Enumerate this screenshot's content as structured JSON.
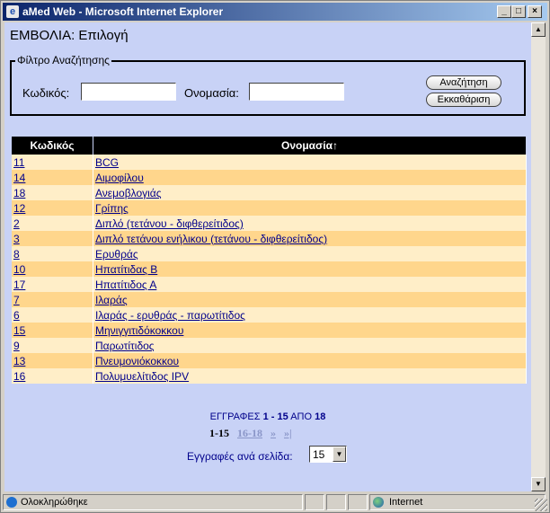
{
  "window": {
    "title": "aMed Web - Microsoft Internet Explorer",
    "minimize": "_",
    "maximize": "□",
    "close": "×"
  },
  "page": {
    "title": "ΕΜΒΟΛΙΑ: Επιλογή"
  },
  "filter": {
    "legend": "Φίλτρο Αναζήτησης",
    "code_label": "Κωδικός:",
    "code_value": "",
    "name_label": "Ονομασία:",
    "name_value": "",
    "search_button": "Αναζήτηση",
    "clear_button": "Εκκαθάριση"
  },
  "table": {
    "headers": {
      "code": "Κωδικός",
      "name": "Ονομασία",
      "sort_indicator": "↑"
    },
    "rows": [
      {
        "code": "11",
        "name": "BCG"
      },
      {
        "code": "14",
        "name": "Αιμοφίλου"
      },
      {
        "code": "18",
        "name": "Ανεμοβλογιάς"
      },
      {
        "code": "12",
        "name": "Γρίπης"
      },
      {
        "code": "2",
        "name": "Διπλό (τετάνου - διφθερείτιδος)"
      },
      {
        "code": "3",
        "name": "Διπλό τετάνου ενήλικου (τετάνου - διφθερείτιδος)"
      },
      {
        "code": "8",
        "name": "Ερυθράς"
      },
      {
        "code": "10",
        "name": "Ηπατίτιδας Β"
      },
      {
        "code": "17",
        "name": "Ηπατίτιδος Α"
      },
      {
        "code": "7",
        "name": "Ιλαράς"
      },
      {
        "code": "6",
        "name": "Ιλαράς - ερυθράς - παρωτίτιδος"
      },
      {
        "code": "15",
        "name": "Μηνιγγιτιδόκοκκου"
      },
      {
        "code": "9",
        "name": "Παρωτίτιδος"
      },
      {
        "code": "13",
        "name": "Πνευμονιόκοκκου"
      },
      {
        "code": "16",
        "name": "Πολυμυελίτιδος IPV"
      }
    ]
  },
  "pager": {
    "records_label": "ΕΓΓΡΑΦΕΣ",
    "range": "1 - 15",
    "of_label": "ΑΠΟ",
    "total": "18",
    "current_page": "1-15",
    "next_page": "16-18",
    "next": "»",
    "last": "»|",
    "per_page_label": "Εγγραφές ανά σελίδα:",
    "per_page_value": "15"
  },
  "statusbar": {
    "status_text": "Ολοκληρώθηκε",
    "zone": "Internet"
  },
  "icons": {
    "app": "ie-icon",
    "zone": "globe-icon"
  },
  "colors": {
    "title_start": "#0a246a",
    "content_bg": "#c8d2f6",
    "row_odd": "#ffeec8",
    "row_even": "#ffd68c",
    "link": "#00008b",
    "header_bg": "#000000"
  }
}
